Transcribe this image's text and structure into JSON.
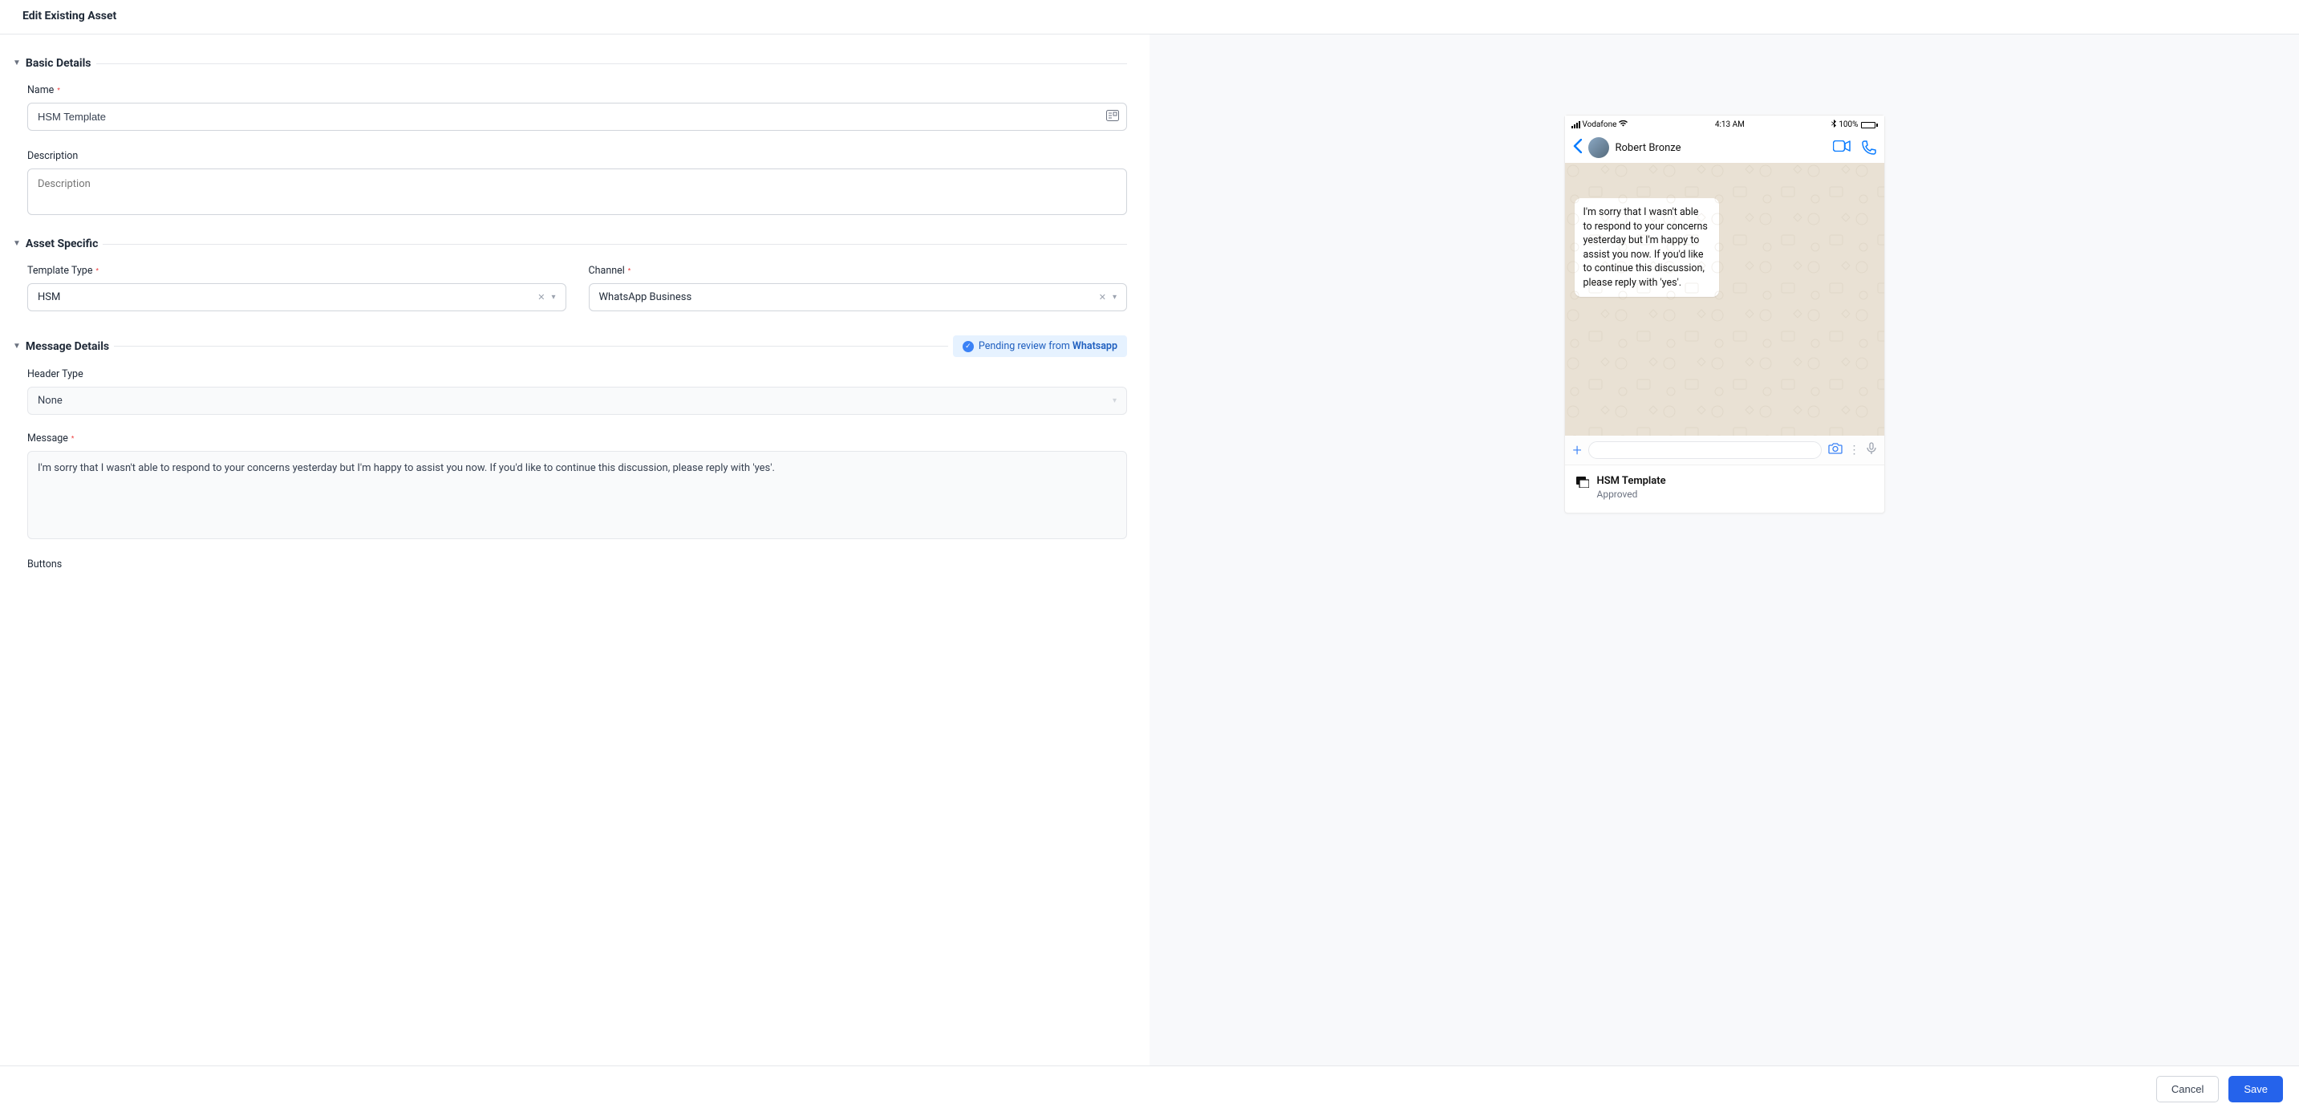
{
  "header": {
    "title": "Edit Existing Asset"
  },
  "sections": {
    "basic": {
      "title": "Basic Details"
    },
    "asset": {
      "title": "Asset Specific"
    },
    "message": {
      "title": "Message Details"
    }
  },
  "fields": {
    "name": {
      "label": "Name",
      "value": "HSM Template"
    },
    "description": {
      "label": "Description",
      "placeholder": "Description",
      "value": ""
    },
    "template_type": {
      "label": "Template Type",
      "value": "HSM"
    },
    "channel": {
      "label": "Channel",
      "value": "WhatsApp Business"
    },
    "header_type": {
      "label": "Header Type",
      "value": "None"
    },
    "message": {
      "label": "Message",
      "value": "I'm sorry that I wasn't able to respond to your concerns yesterday but I'm happy to assist you now. If you'd like to continue this discussion, please reply with 'yes'."
    },
    "buttons": {
      "label": "Buttons"
    }
  },
  "status_pill": {
    "prefix": "Pending review from ",
    "strong": "Whatsapp"
  },
  "preview": {
    "carrier": "Vodafone",
    "time": "4:13 AM",
    "battery": "100%",
    "contact": "Robert Bronze",
    "bubble": "I'm sorry that I wasn't able to respond to your concerns yesterday but I'm happy to assist you now. If you'd like to continue this discussion, please reply with 'yes'.",
    "card_title": "HSM Template",
    "card_status": "Approved"
  },
  "footer": {
    "cancel": "Cancel",
    "save": "Save"
  }
}
